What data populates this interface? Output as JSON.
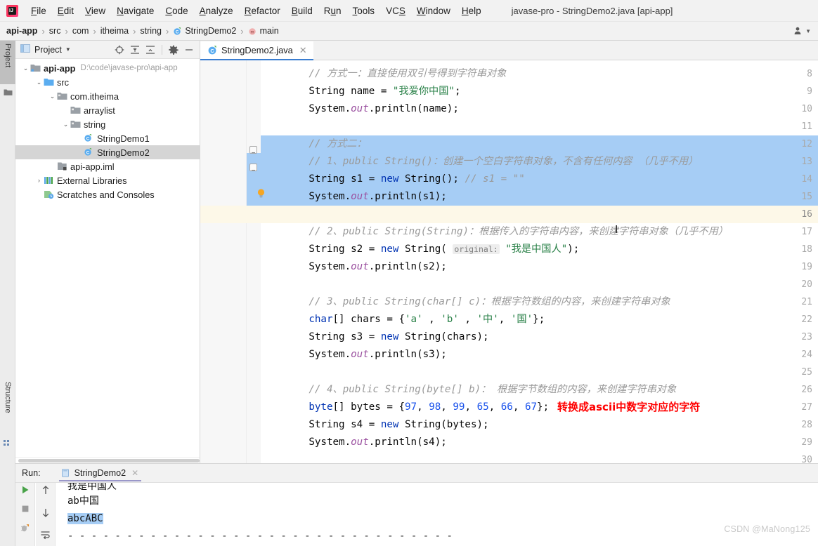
{
  "window": {
    "title": "javase-pro - StringDemo2.java [api-app]",
    "logo_icon": "intellij-idea-logo"
  },
  "menubar": {
    "items": [
      {
        "label": "File",
        "mnemonic": "F"
      },
      {
        "label": "Edit",
        "mnemonic": "E"
      },
      {
        "label": "View",
        "mnemonic": "V"
      },
      {
        "label": "Navigate",
        "mnemonic": "N"
      },
      {
        "label": "Code",
        "mnemonic": "C"
      },
      {
        "label": "Analyze",
        "mnemonic": "A"
      },
      {
        "label": "Refactor",
        "mnemonic": "R"
      },
      {
        "label": "Build",
        "mnemonic": "B"
      },
      {
        "label": "Run",
        "mnemonic": "u"
      },
      {
        "label": "Tools",
        "mnemonic": "T"
      },
      {
        "label": "VCS",
        "mnemonic": "S"
      },
      {
        "label": "Window",
        "mnemonic": "W"
      },
      {
        "label": "Help",
        "mnemonic": "H"
      }
    ]
  },
  "navbar": {
    "crumbs": [
      {
        "label": "api-app",
        "icon": null
      },
      {
        "label": "src",
        "icon": null
      },
      {
        "label": "com",
        "icon": null
      },
      {
        "label": "itheima",
        "icon": null
      },
      {
        "label": "string",
        "icon": null
      },
      {
        "label": "StringDemo2",
        "icon": "java-class-icon"
      },
      {
        "label": "main",
        "icon": "java-method-icon"
      }
    ],
    "separator": "›",
    "account_icon": "user-account-icon"
  },
  "left_tool_strip": {
    "tabs": [
      {
        "label": "Project",
        "active": true,
        "icon": "project-folder-icon"
      },
      {
        "label": "Structure",
        "active": false,
        "icon": "structure-icon"
      },
      {
        "label": "Favorites",
        "active": false,
        "icon": "favorites-icon"
      }
    ]
  },
  "project_panel": {
    "title": "Project",
    "caret_icon": "chevron-down-icon",
    "toolbar": [
      {
        "name": "locate-file-icon",
        "glyph": "⊕"
      },
      {
        "name": "expand-all-icon",
        "glyph": "⤓"
      },
      {
        "name": "collapse-all-icon",
        "glyph": "⤒"
      },
      {
        "name": "gear-icon",
        "glyph": "⚙"
      },
      {
        "name": "hide-panel-icon",
        "glyph": "−"
      }
    ],
    "tree": [
      {
        "label": "api-app",
        "path": "D:\\code\\javase-pro\\api-app",
        "depth": 0,
        "twist": "expanded",
        "icon": "module-icon",
        "bold": true,
        "selected": false
      },
      {
        "label": "src",
        "path": "",
        "depth": 1,
        "twist": "expanded",
        "icon": "source-root-icon",
        "bold": false,
        "selected": false
      },
      {
        "label": "com.itheima",
        "path": "",
        "depth": 2,
        "twist": "expanded",
        "icon": "package-icon",
        "bold": false,
        "selected": false
      },
      {
        "label": "arraylist",
        "path": "",
        "depth": 3,
        "twist": "none",
        "icon": "package-icon",
        "bold": false,
        "selected": false
      },
      {
        "label": "string",
        "path": "",
        "depth": 3,
        "twist": "expanded",
        "icon": "package-icon",
        "bold": false,
        "selected": false
      },
      {
        "label": "StringDemo1",
        "path": "",
        "depth": 4,
        "twist": "none",
        "icon": "java-class-icon",
        "bold": false,
        "selected": false
      },
      {
        "label": "StringDemo2",
        "path": "",
        "depth": 4,
        "twist": "none",
        "icon": "java-class-icon",
        "bold": false,
        "selected": true
      },
      {
        "label": "api-app.iml",
        "path": "",
        "depth": 2,
        "twist": "none",
        "icon": "iml-file-icon",
        "bold": false,
        "selected": false
      },
      {
        "label": "External Libraries",
        "path": "",
        "depth": 1,
        "twist": "collapsed",
        "icon": "libraries-icon",
        "bold": false,
        "selected": false
      },
      {
        "label": "Scratches and Consoles",
        "path": "",
        "depth": 1,
        "twist": "none",
        "icon": "scratches-icon",
        "bold": false,
        "selected": false
      }
    ]
  },
  "editor": {
    "tab": {
      "label": "StringDemo2.java",
      "icon": "java-class-icon",
      "close_icon": "close-icon",
      "active": true
    },
    "first_line_number": 8,
    "last_line_number": 30,
    "current_line": 16,
    "selection_lines": [
      12,
      15
    ],
    "bulb_line": 15,
    "lines": [
      {
        "n": 8,
        "indent": 8,
        "segments": [
          {
            "t": "// 方式一：直接使用双引号得到字符串对象",
            "c": "cmt"
          }
        ]
      },
      {
        "n": 9,
        "indent": 8,
        "segments": [
          {
            "t": "String name = ",
            "c": ""
          },
          {
            "t": "\"我爱你中国\"",
            "c": "str"
          },
          {
            "t": ";",
            "c": ""
          }
        ]
      },
      {
        "n": 10,
        "indent": 8,
        "segments": [
          {
            "t": "System.",
            "c": ""
          },
          {
            "t": "out",
            "c": "fld"
          },
          {
            "t": ".println(name);",
            "c": ""
          }
        ]
      },
      {
        "n": 11,
        "indent": 0,
        "segments": []
      },
      {
        "n": 12,
        "indent": 8,
        "segments": [
          {
            "t": "// 方式二：",
            "c": "cmt"
          }
        ]
      },
      {
        "n": 13,
        "indent": 8,
        "segments": [
          {
            "t": "// 1、public String()：创建一个空白字符串对象，不含有任何内容 （几乎不用）",
            "c": "cmt"
          }
        ]
      },
      {
        "n": 14,
        "indent": 8,
        "segments": [
          {
            "t": "String s1 = ",
            "c": ""
          },
          {
            "t": "new",
            "c": "kw"
          },
          {
            "t": " String(); ",
            "c": ""
          },
          {
            "t": "// s1 = \"\"",
            "c": "cmt"
          }
        ]
      },
      {
        "n": 15,
        "indent": 8,
        "segments": [
          {
            "t": "System.",
            "c": ""
          },
          {
            "t": "out",
            "c": "fld"
          },
          {
            "t": ".println(s1);",
            "c": ""
          }
        ]
      },
      {
        "n": 16,
        "indent": 0,
        "segments": []
      },
      {
        "n": 17,
        "indent": 8,
        "segments": [
          {
            "t": "// 2、public String(String)：根据传入的字符串内容，来创建字符串对象（几乎不用）",
            "c": "cmt"
          }
        ]
      },
      {
        "n": 18,
        "indent": 8,
        "segments": [
          {
            "t": "String s2 = ",
            "c": ""
          },
          {
            "t": "new",
            "c": "kw"
          },
          {
            "t": " String( ",
            "c": ""
          },
          {
            "t": "original:",
            "c": "hint"
          },
          {
            "t": " ",
            "c": ""
          },
          {
            "t": "\"我是中国人\"",
            "c": "str"
          },
          {
            "t": ");",
            "c": ""
          }
        ]
      },
      {
        "n": 19,
        "indent": 8,
        "segments": [
          {
            "t": "System.",
            "c": ""
          },
          {
            "t": "out",
            "c": "fld"
          },
          {
            "t": ".println(s2);",
            "c": ""
          }
        ]
      },
      {
        "n": 20,
        "indent": 0,
        "segments": []
      },
      {
        "n": 21,
        "indent": 8,
        "segments": [
          {
            "t": "// 3、public String(char[] c)：根据字符数组的内容，来创建字符串对象",
            "c": "cmt"
          }
        ]
      },
      {
        "n": 22,
        "indent": 8,
        "segments": [
          {
            "t": "char",
            "c": "kw"
          },
          {
            "t": "[] chars = {",
            "c": ""
          },
          {
            "t": "'a'",
            "c": "str"
          },
          {
            "t": " , ",
            "c": ""
          },
          {
            "t": "'b'",
            "c": "str"
          },
          {
            "t": " , ",
            "c": ""
          },
          {
            "t": "'中'",
            "c": "str"
          },
          {
            "t": ", ",
            "c": ""
          },
          {
            "t": "'国'",
            "c": "str"
          },
          {
            "t": "};",
            "c": ""
          }
        ]
      },
      {
        "n": 23,
        "indent": 8,
        "segments": [
          {
            "t": "String s3 = ",
            "c": ""
          },
          {
            "t": "new",
            "c": "kw"
          },
          {
            "t": " String(chars);",
            "c": ""
          }
        ]
      },
      {
        "n": 24,
        "indent": 8,
        "segments": [
          {
            "t": "System.",
            "c": ""
          },
          {
            "t": "out",
            "c": "fld"
          },
          {
            "t": ".println(s3);",
            "c": ""
          }
        ]
      },
      {
        "n": 25,
        "indent": 0,
        "segments": []
      },
      {
        "n": 26,
        "indent": 8,
        "segments": [
          {
            "t": "// 4、public String(byte[] b)： 根据字节数组的内容，来创建字符串对象",
            "c": "cmt"
          }
        ]
      },
      {
        "n": 27,
        "indent": 8,
        "segments": [
          {
            "t": "byte",
            "c": "kw"
          },
          {
            "t": "[] bytes = {",
            "c": ""
          },
          {
            "t": "97",
            "c": "num"
          },
          {
            "t": ", ",
            "c": ""
          },
          {
            "t": "98",
            "c": "num"
          },
          {
            "t": ", ",
            "c": ""
          },
          {
            "t": "99",
            "c": "num"
          },
          {
            "t": ", ",
            "c": ""
          },
          {
            "t": "65",
            "c": "num"
          },
          {
            "t": ", ",
            "c": ""
          },
          {
            "t": "66",
            "c": "num"
          },
          {
            "t": ", ",
            "c": ""
          },
          {
            "t": "67",
            "c": "num"
          },
          {
            "t": "};",
            "c": ""
          }
        ]
      },
      {
        "n": 28,
        "indent": 8,
        "segments": [
          {
            "t": "String s4 = ",
            "c": ""
          },
          {
            "t": "new",
            "c": "kw"
          },
          {
            "t": " String(bytes);",
            "c": ""
          }
        ]
      },
      {
        "n": 29,
        "indent": 8,
        "segments": [
          {
            "t": "System.",
            "c": ""
          },
          {
            "t": "out",
            "c": "fld"
          },
          {
            "t": ".println(s4);",
            "c": ""
          }
        ]
      },
      {
        "n": 30,
        "indent": 0,
        "segments": []
      }
    ],
    "annotation": {
      "text": "转换成ascii中数字对应的字符",
      "line": 27,
      "color": "#ff0000"
    },
    "colors": {
      "selection": "#a6cdf5",
      "caret_line": "#fdf8e8",
      "keyword": "#0033b3",
      "string": "#2a8148",
      "comment": "#9a9a9a",
      "number": "#1750eb",
      "field": "#9b51a0"
    }
  },
  "run_panel": {
    "label": "Run:",
    "tab": {
      "label": "StringDemo2",
      "icon": "run-config-icon",
      "close_icon": "close-icon"
    },
    "toolbar_left": [
      {
        "name": "rerun-button",
        "glyph": "▶"
      },
      {
        "name": "stop-button",
        "glyph": "■"
      },
      {
        "name": "debug-button",
        "glyph": "✕"
      }
    ],
    "toolbar_right": [
      {
        "name": "scroll-up-button",
        "glyph": "↑"
      },
      {
        "name": "scroll-down-button",
        "glyph": "↓"
      },
      {
        "name": "soft-wrap-button",
        "glyph": "↪"
      }
    ],
    "console_lines": [
      {
        "text": "我是中国人",
        "highlight": false,
        "clipped": true
      },
      {
        "text": "ab中国",
        "highlight": false,
        "clipped": false
      },
      {
        "text": "abcABC",
        "highlight": true,
        "clipped": false
      },
      {
        "text": "- - - - - - - - - - - - - - - - - - - - - - - - - - - - - - - - -",
        "highlight": false,
        "clipped": false
      }
    ]
  },
  "watermark": {
    "text": "CSDN @MaNong125"
  }
}
